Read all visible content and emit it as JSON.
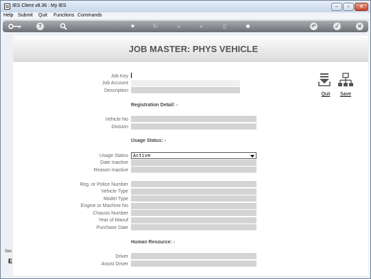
{
  "window": {
    "title": "IES Client v8.36 : My IES",
    "controls": {
      "minimize": "–",
      "maximize": "▫",
      "close": "✕"
    }
  },
  "menu": [
    "Help",
    "Submit",
    "Quit",
    "Functions",
    "Commands"
  ],
  "toolbar": {
    "icons": [
      "key-icon",
      "help-icon",
      "search-icon",
      "heart-icon",
      "refresh-icon",
      "rewind-icon",
      "fast-forward-icon",
      "bookmark-icon",
      "stop-icon",
      "back-icon",
      "check-icon",
      "close-icon"
    ]
  },
  "page": {
    "title": "JOB MASTER: PHYS VEHICLE",
    "fields": {
      "job_key": "Job Key",
      "job_account": "Job Account",
      "description": "Description",
      "vehicle_no": "Vehicle No",
      "division": "Division",
      "usage_status": "Usage Status",
      "date_inactive": "Date Inactive",
      "reason_inactive": "Reason Inactive",
      "reg_number": "Reg. or Police Number",
      "vehicle_type": "Vehicle Type",
      "model_type": "Model Type",
      "engine_number": "Engine or Machine No",
      "chassis_number": "Chassis Number",
      "year_of_manuf": "Year of Manuf",
      "purchase_date": "Purchase Date",
      "driver": "Driver",
      "assist_driver": "Assist Driver"
    },
    "values": {
      "job_key": "",
      "usage_status": "Active"
    },
    "sections": {
      "registration": "Registration Detail: -",
      "usage": "Usage Status: -",
      "human_resource": "Human Resource: -"
    },
    "actions": {
      "quit": "Quit",
      "save": "Save"
    }
  },
  "side_tab": {
    "label": "Ses",
    "mark": "E"
  }
}
